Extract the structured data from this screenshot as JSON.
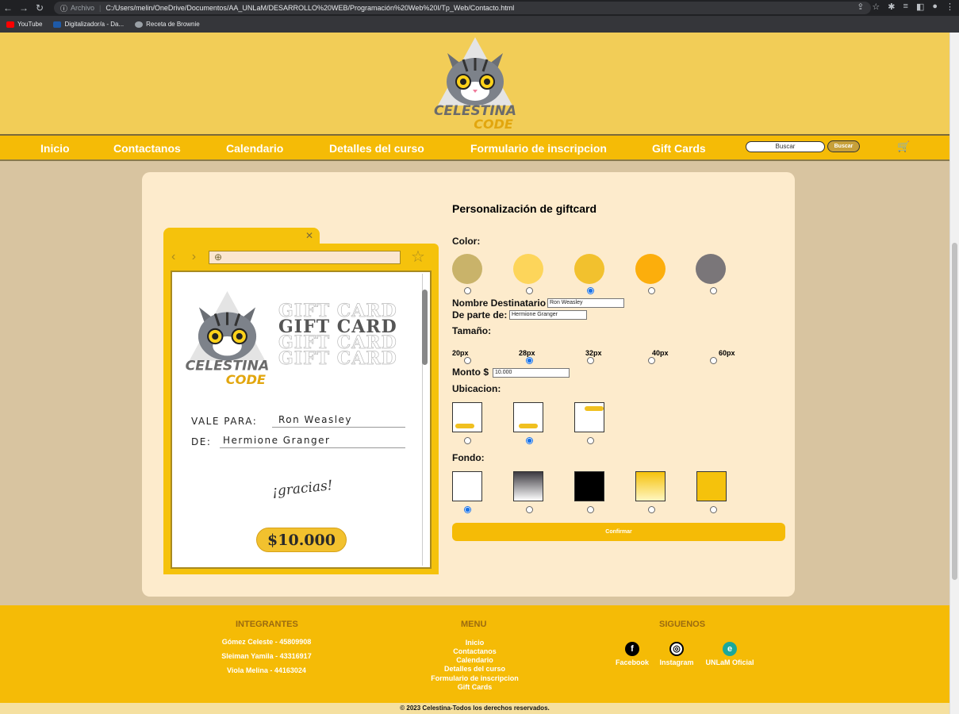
{
  "browser": {
    "protocol": "Archivo",
    "url": "C:/Users/melin/OneDrive/Documentos/AA_UNLaM/DESARROLLO%20WEB/Programación%20Web%20I/Tp_Web/Contacto.html",
    "bookmarks": [
      "YouTube",
      "Digitalizador/a - Da...",
      "Receta de Brownie"
    ]
  },
  "header": {
    "logo_text_top": "CELESTINA",
    "logo_text_bottom": "CODE"
  },
  "nav": {
    "items": [
      "Inicio",
      "Contactanos",
      "Calendario",
      "Detalles del curso",
      "Formulario de inscripcion",
      "Gift Cards"
    ],
    "search_placeholder": "Buscar",
    "search_button": "Buscar"
  },
  "preview": {
    "gift_card_text": "GIFT CARD",
    "vale_para_label": "VALE PARA:",
    "vale_para_value": "Ron Weasley",
    "de_label": "DE:",
    "de_value": "Hermione Granger",
    "gracias": "¡gracias!",
    "amount": "$10.000"
  },
  "form": {
    "title": "Personalización de giftcard",
    "color_label": "Color:",
    "colors": [
      "#c9b36a",
      "#fdd55a",
      "#f2c12e",
      "#fcae0c",
      "#7a7679"
    ],
    "selected_color_index": 2,
    "recipient_label": "Nombre Destinatario",
    "recipient_value": "Ron Weasley",
    "from_label": "De parte de:",
    "from_value": "Hermione Granger",
    "size_label": "Tamaño:",
    "sizes": [
      "20px",
      "28px",
      "32px",
      "40px",
      "60px"
    ],
    "selected_size_index": 1,
    "amount_label": "Monto $",
    "amount_value": "10.000",
    "location_label": "Ubicacion:",
    "selected_location_index": 1,
    "background_label": "Fondo:",
    "selected_background_index": 0,
    "confirm_button": "Confirmar"
  },
  "footer": {
    "members_title": "INTEGRANTES",
    "members": [
      "Gómez Celeste - 45809908",
      "Sleiman Yamila - 43316917",
      "Viola Melina - 44163024"
    ],
    "menu_title": "MENU",
    "menu": [
      "Inicio",
      "Contactanos",
      "Calendario",
      "Detalles del curso",
      "Formulario de inscripcion",
      "Gift Cards"
    ],
    "follow_title": "SIGUENOS",
    "social": [
      "Facebook",
      "Instagram",
      "UNLaM Oficial"
    ],
    "copyright": "© 2023 Celestina-Todos los derechos reservados."
  }
}
